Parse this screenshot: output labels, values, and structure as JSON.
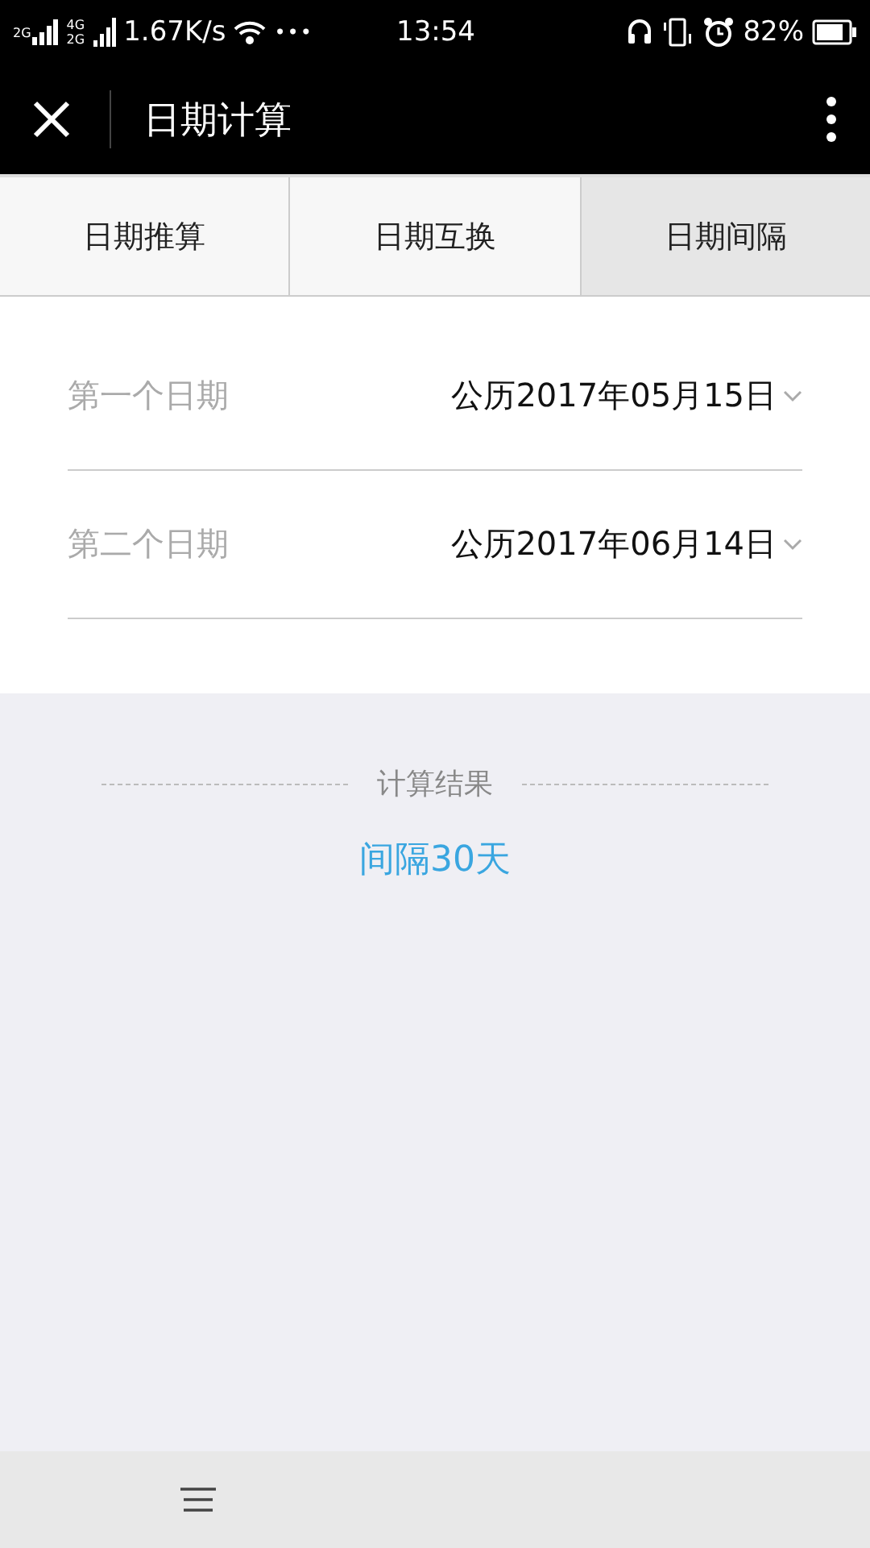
{
  "status_bar": {
    "sim1_label": "2G",
    "sim2_labels": [
      "4G",
      "2G"
    ],
    "speed": "1.67K/s",
    "more": "•••",
    "time": "13:54",
    "battery": "82%"
  },
  "header": {
    "title": "日期计算"
  },
  "tabs": [
    {
      "label": "日期推算",
      "selected": false
    },
    {
      "label": "日期互换",
      "selected": false
    },
    {
      "label": "日期间隔",
      "selected": true
    }
  ],
  "fields": [
    {
      "label": "第一个日期",
      "value": "公历2017年05月15日"
    },
    {
      "label": "第二个日期",
      "value": "公历2017年06月14日"
    }
  ],
  "result": {
    "heading": "计算结果",
    "value": "间隔30天"
  }
}
